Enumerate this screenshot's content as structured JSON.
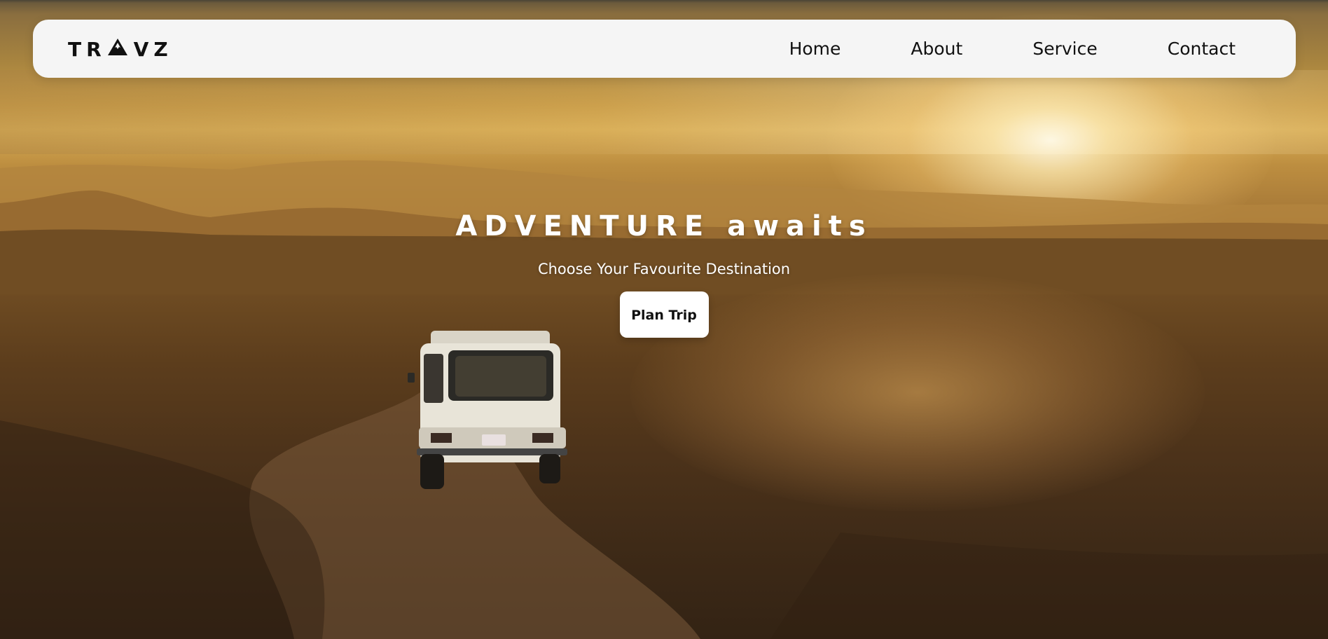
{
  "brand": {
    "logo_left": "TR",
    "logo_right": "VZ",
    "logo_mark_icon": "mountain-triangle-icon"
  },
  "nav": {
    "items": [
      {
        "label": "Home"
      },
      {
        "label": "About"
      },
      {
        "label": "Service"
      },
      {
        "label": "Contact"
      }
    ]
  },
  "hero": {
    "title": "ADVENTURE awaits",
    "subtitle": "Choose Your Favourite Destination",
    "cta_label": "Plan Trip",
    "background_description_icon": "desert-road-van-photo"
  },
  "colors": {
    "navbar_bg": "#f5f5f5",
    "text_dark": "#111111",
    "hero_text": "#ffffff",
    "button_bg": "#ffffff"
  }
}
